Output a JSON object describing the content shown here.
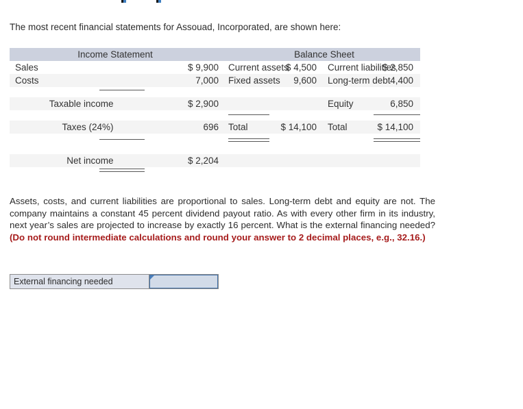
{
  "intro": {
    "text": "The most recent financial statements for Assouad, Incorporated, are shown here:"
  },
  "statement_table": {
    "headers": {
      "income_statement": "Income Statement",
      "balance_sheet": "Balance Sheet"
    },
    "income_statement": [
      {
        "label": "Sales",
        "value": "$ 9,900"
      },
      {
        "label": "Costs",
        "value": "7,000"
      },
      {
        "label": "Taxable income",
        "value": "$ 2,900"
      },
      {
        "label": "Taxes (24%)",
        "value": "696"
      },
      {
        "label": "Net income",
        "value": "$ 2,204"
      }
    ],
    "balance_assets": [
      {
        "label": "Current assets",
        "value": "$ 4,500"
      },
      {
        "label": "Fixed assets",
        "value": "9,600"
      },
      {
        "label": "Total",
        "value": "$ 14,100"
      }
    ],
    "balance_liabilities": [
      {
        "label": "Current liabilities",
        "value": "$ 2,850"
      },
      {
        "label": "Long-term debt",
        "value": "4,400"
      },
      {
        "label": "Equity",
        "value": "6,850"
      },
      {
        "label": "Total",
        "value": "$ 14,100"
      }
    ]
  },
  "question": {
    "body": "Assets, costs, and current liabilities are proportional to sales. Long-term debt and equity are not. The company maintains a constant 45 percent dividend payout ratio. As with every other firm in its industry, next year’s sales are projected to increase by exactly 16 percent. What is the external financing needed? ",
    "emphasis": "(Do not round intermediate calculations and round your answer to 2 decimal places, e.g., 32.16.)"
  },
  "answer": {
    "label": "External financing needed",
    "value": "",
    "placeholder": ""
  },
  "colors": {
    "header_band": "#ccd1de",
    "row_shade": "#f4f4f4",
    "emphasis_red": "#a61c1c",
    "input_border": "#4472a8",
    "input_fill": "#d2dbe8",
    "label_fill": "#dfe3ec"
  }
}
